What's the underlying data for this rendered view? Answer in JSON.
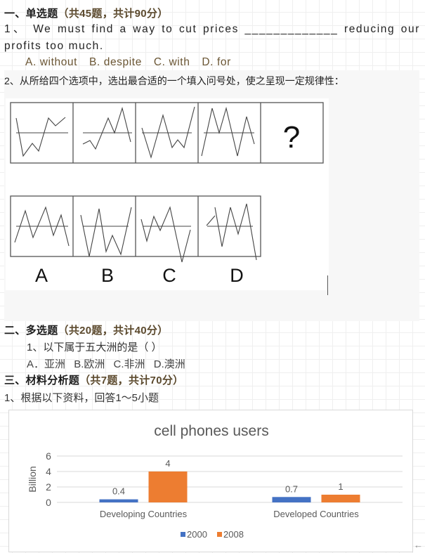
{
  "section1": {
    "heading_prefix": "一、单选题",
    "heading_meta": "（共45题，共计90分）",
    "q1": {
      "text": "1、 We must find a way to cut prices _____________ reducing our profits too much.",
      "options": [
        "A. without",
        "B. despite",
        "C. with",
        "D. for"
      ]
    },
    "q2": {
      "text": "2、从所给四个选项中，选出最合适的一个填入问号处，使之呈现一定规律性：",
      "question_mark": "?",
      "option_labels": [
        "A",
        "B",
        "C",
        "D"
      ]
    }
  },
  "section2": {
    "heading_prefix": "二、多选题",
    "heading_meta": "（共20题，共计40分）",
    "q1": {
      "text": "1、以下属于五大洲的是（ ）",
      "options": [
        "A．亚洲",
        "B.欧洲",
        "C.非洲",
        "D.澳洲"
      ]
    }
  },
  "section3": {
    "heading_prefix": "三、材料分析题",
    "heading_meta": "（共7题，共计70分）",
    "q1": {
      "text": "1、根据以下资料，回答1～5小题"
    }
  },
  "colors": {
    "series_2000": "#4472c4",
    "series_2008": "#ed7d31"
  },
  "chart_data": {
    "type": "bar",
    "title": "cell phones users",
    "xlabel": "",
    "ylabel": "Billion",
    "categories": [
      "Developing Countries",
      "Developed Countries"
    ],
    "series": [
      {
        "name": "2000",
        "values": [
          0.4,
          0.7
        ],
        "labels": [
          "0.4",
          "0.7"
        ]
      },
      {
        "name": "2008",
        "values": [
          4,
          1
        ],
        "labels": [
          "4",
          "1"
        ]
      }
    ],
    "ylim": [
      0,
      6
    ],
    "yticks": [
      "0",
      "2",
      "4",
      "6"
    ],
    "grid": true,
    "legend": "bottom"
  },
  "ui": {
    "back_arrow": "←"
  }
}
